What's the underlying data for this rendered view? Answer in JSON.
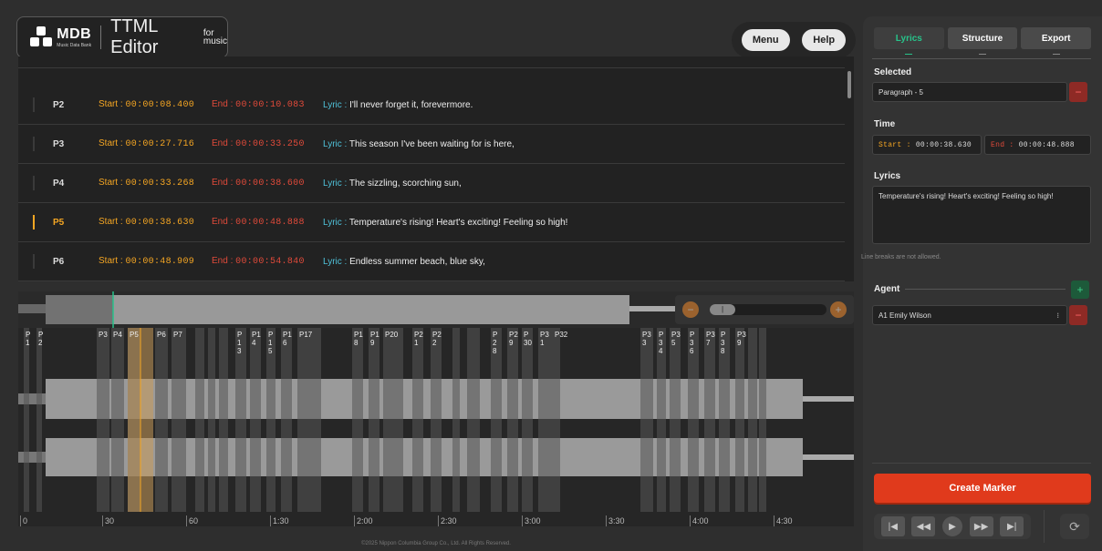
{
  "header": {
    "logo_text": "MDB",
    "logo_subtext": "Music Data Bank",
    "app_title": "TTML Editor",
    "app_title_sup1": "for",
    "app_title_sup2": "music",
    "menu_label": "Menu",
    "help_label": "Help"
  },
  "labels": {
    "start": "Start :",
    "end": "End :",
    "lyric": "Lyric :"
  },
  "rows": [
    {
      "id": "P2",
      "start": "00:00:08.400",
      "end": "00:00:10.083",
      "lyric": "I'll never forget it, forevermore.",
      "active": false
    },
    {
      "id": "P3",
      "start": "00:00:27.716",
      "end": "00:00:33.250",
      "lyric": "This season I've been waiting for is here,",
      "active": false
    },
    {
      "id": "P4",
      "start": "00:00:33.268",
      "end": "00:00:38.600",
      "lyric": "The sizzling, scorching sun,",
      "active": false
    },
    {
      "id": "P5",
      "start": "00:00:38.630",
      "end": "00:00:48.888",
      "lyric": "Temperature's rising! Heart's exciting! Feeling so high!",
      "active": true
    },
    {
      "id": "P6",
      "start": "00:00:48.909",
      "end": "00:00:54.840",
      "lyric": "Endless summer beach, blue sky,",
      "active": false
    }
  ],
  "timeline": {
    "labels": [
      "0",
      "30",
      "60",
      "1:30",
      "2:00",
      "2:30",
      "3:00",
      "3:30",
      "4:00",
      "4:30"
    ]
  },
  "markers": [
    "P1",
    "P2",
    "P3",
    "P4",
    "P5",
    "P6",
    "P7",
    "P14",
    "P16",
    "P17",
    "P18",
    "P19",
    "P20",
    "P21",
    "P22",
    "P27",
    "P29",
    "P30",
    "P31",
    "P32",
    "P33",
    "P34",
    "P35",
    "P36",
    "P37",
    "P38",
    "P39"
  ],
  "footer": "©2025 Nippon Columbia Group Co., Ltd. All Rights Reserved.",
  "panel": {
    "tabs": [
      "Lyrics",
      "Structure",
      "Export"
    ],
    "active_tab": "Lyrics",
    "selected_label": "Selected",
    "selected_value": "Paragraph - 5",
    "time_label": "Time",
    "start_label": "Start :",
    "start_value": "00:00:38.630",
    "end_label": "End :",
    "end_value": "00:00:48.888",
    "lyrics_label": "Lyrics",
    "lyrics_value": "Temperature's rising! Heart's exciting! Feeling so high!",
    "hint": "Line breaks are not allowed.",
    "agent_label": "Agent",
    "agent_value": "A1 Emily Wilson",
    "create_label": "Create Marker"
  },
  "colors": {
    "accent_green": "#27c38a",
    "start_orange": "#f5a623",
    "end_red": "#e04a3a",
    "create_red": "#e03a1c"
  }
}
